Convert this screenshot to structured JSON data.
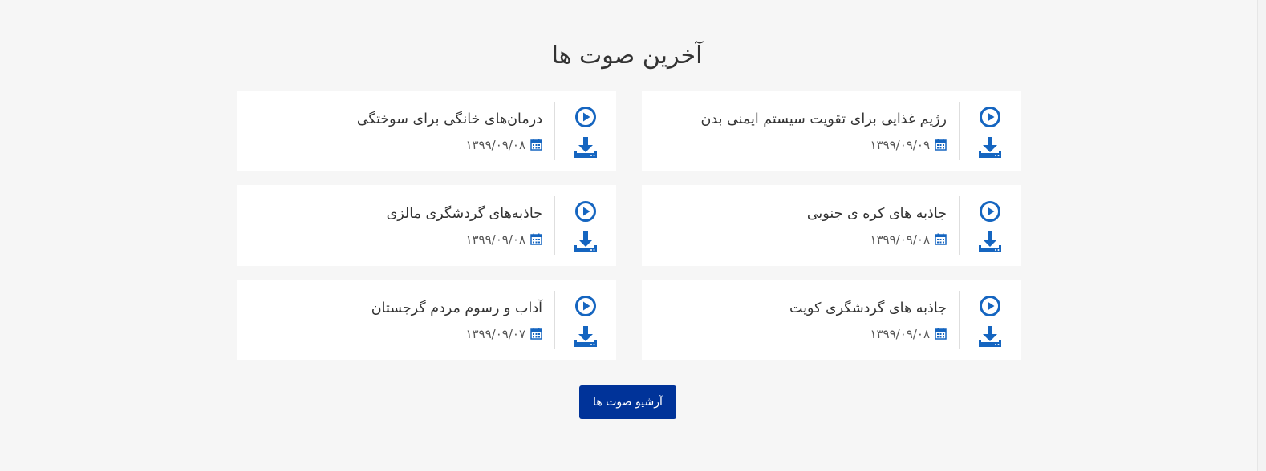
{
  "section": {
    "title": "آخرین صوت ها"
  },
  "colors": {
    "accent": "#1565c0",
    "button_bg": "#003399",
    "page_bg": "#f6f6f6",
    "card_bg": "#ffffff"
  },
  "icons": {
    "play": "play-circle-icon",
    "download": "download-icon",
    "date": "calendar-icon"
  },
  "items": [
    {
      "title": "رژیم غذایی برای تقویت سیستم ایمنی بدن",
      "date": "۱۳۹۹/۰۹/۰۹"
    },
    {
      "title": "درمان‌های خانگی برای سوختگی",
      "date": "۱۳۹۹/۰۹/۰۸"
    },
    {
      "title": "جاذبه های کره ی جنوبی",
      "date": "۱۳۹۹/۰۹/۰۸"
    },
    {
      "title": "جاذبه‌های گردشگری مالزی",
      "date": "۱۳۹۹/۰۹/۰۸"
    },
    {
      "title": "جاذبه های گردشگری کویت",
      "date": "۱۳۹۹/۰۹/۰۸"
    },
    {
      "title": "آداب و رسوم مردم گرجستان",
      "date": "۱۳۹۹/۰۹/۰۷"
    }
  ],
  "archive_button": {
    "label": "آرشیو صوت ها"
  }
}
